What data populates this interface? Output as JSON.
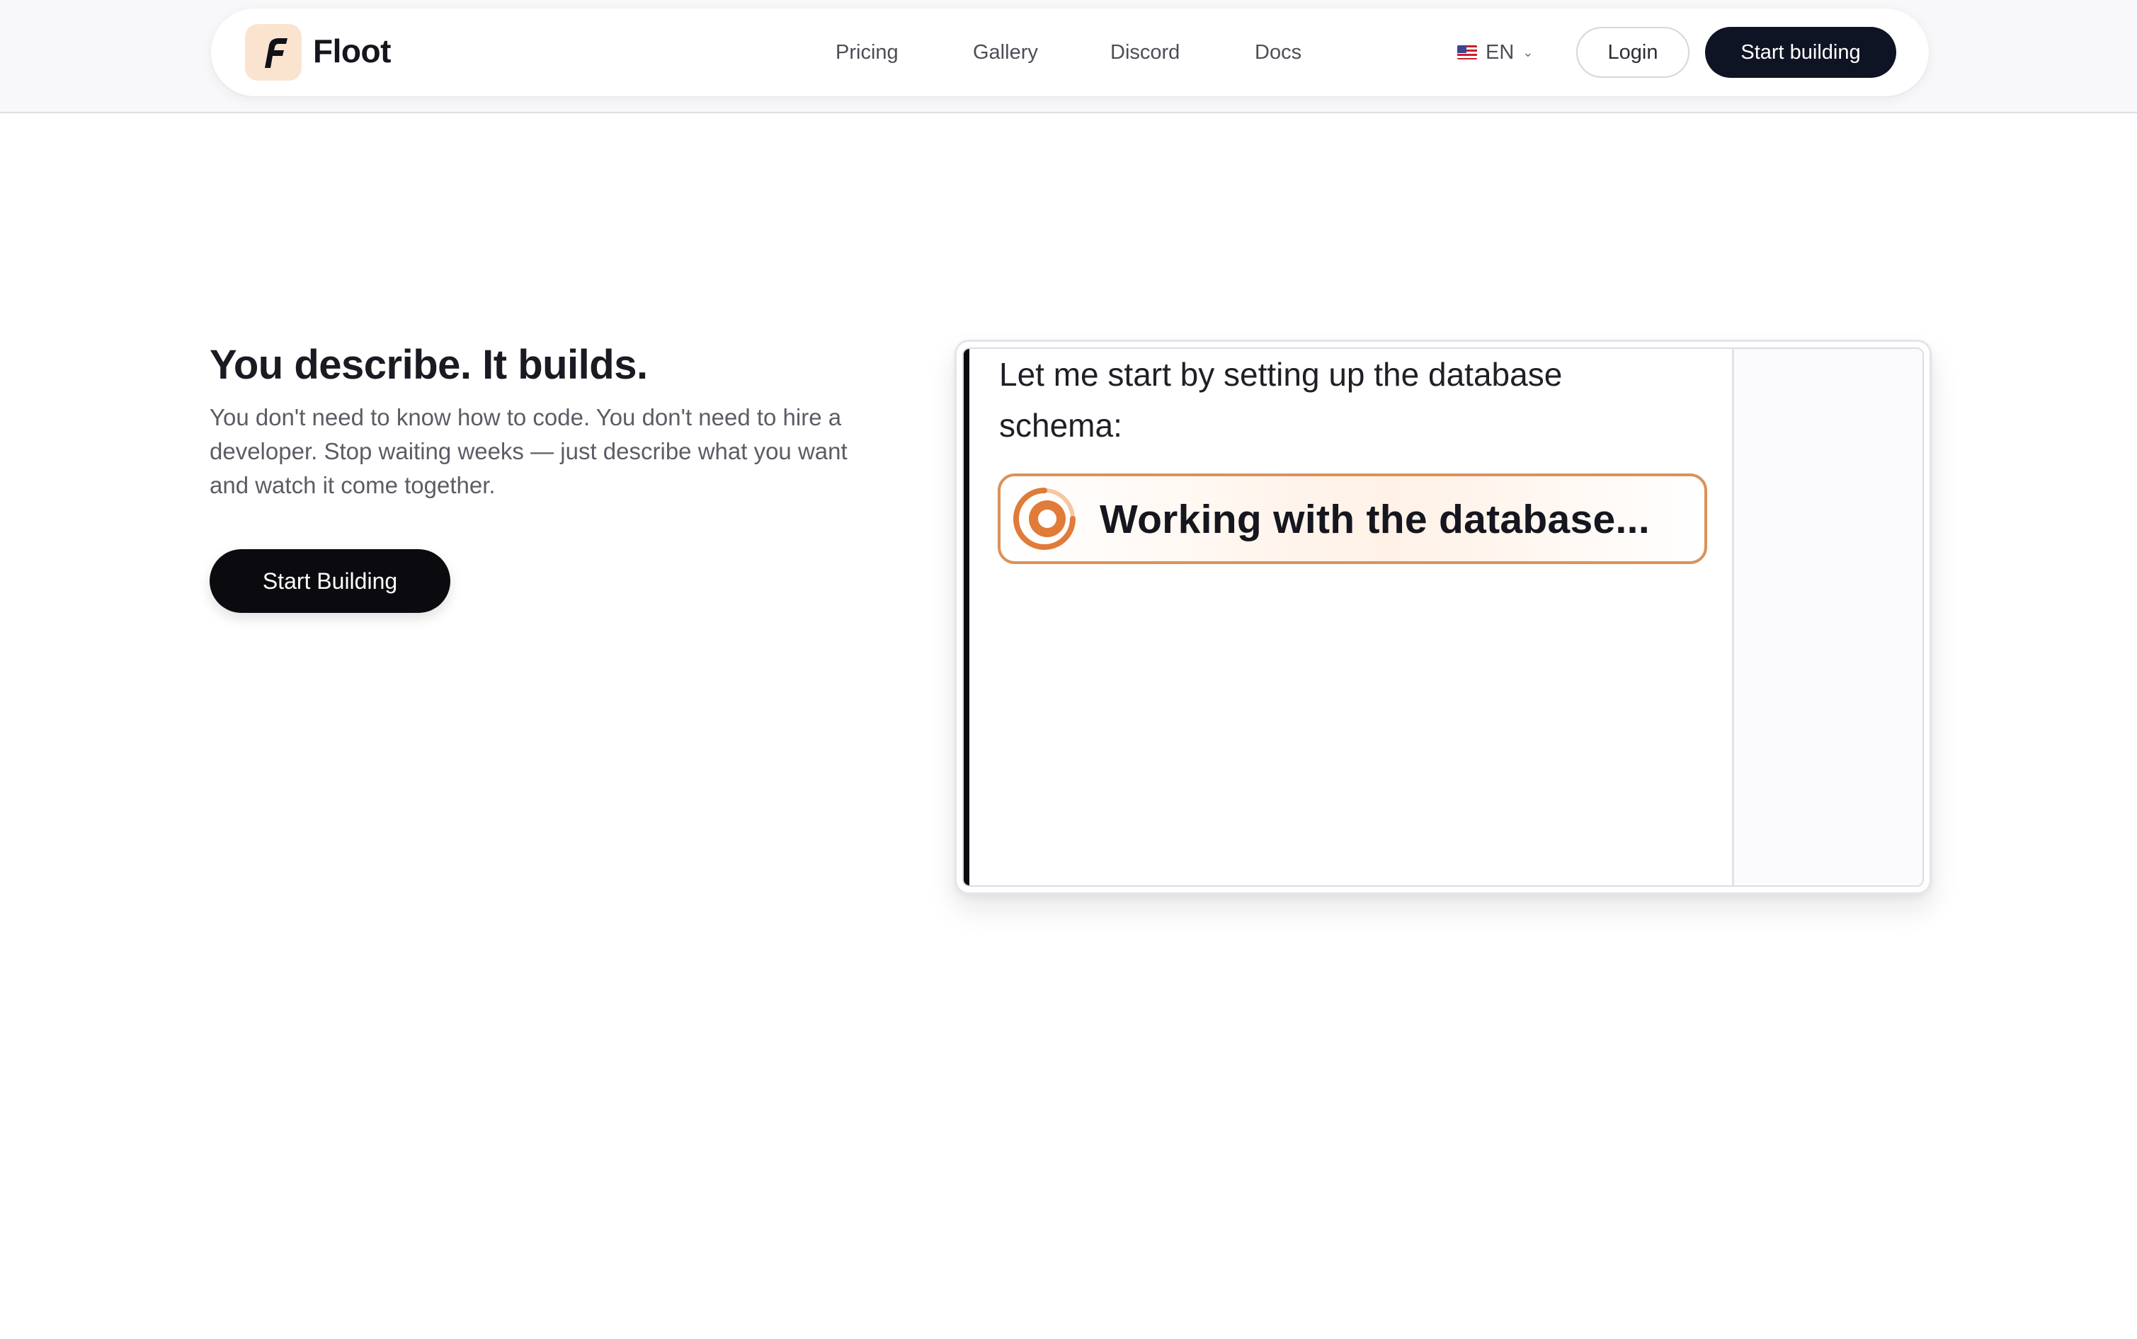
{
  "header": {
    "brand": "Floot",
    "nav": [
      {
        "label": "Pricing"
      },
      {
        "label": "Gallery"
      },
      {
        "label": "Discord"
      },
      {
        "label": "Docs"
      }
    ],
    "language": "EN",
    "login_label": "Login",
    "cta_label": "Start building"
  },
  "hero": {
    "title": "You describe. It builds.",
    "description": "You don't need to know how to code. You don't need to hire a developer. Stop waiting weeks — just describe what you want and watch it come together.",
    "cta_label": "Start Building"
  },
  "demo": {
    "message": "Let me start by setting up the database schema:",
    "status": "Working with the database..."
  },
  "icons": {
    "logo": "floot-logo-icon",
    "flag": "us-flag-icon",
    "chevron": "chevron-down-icon",
    "spinner": "spinner-icon"
  },
  "colors": {
    "navy_button": "#0f1424",
    "black_button": "#0a0a0f",
    "logo_bg": "#fbe4cf",
    "status_accent": "#e07b39",
    "status_border": "#db9259"
  }
}
